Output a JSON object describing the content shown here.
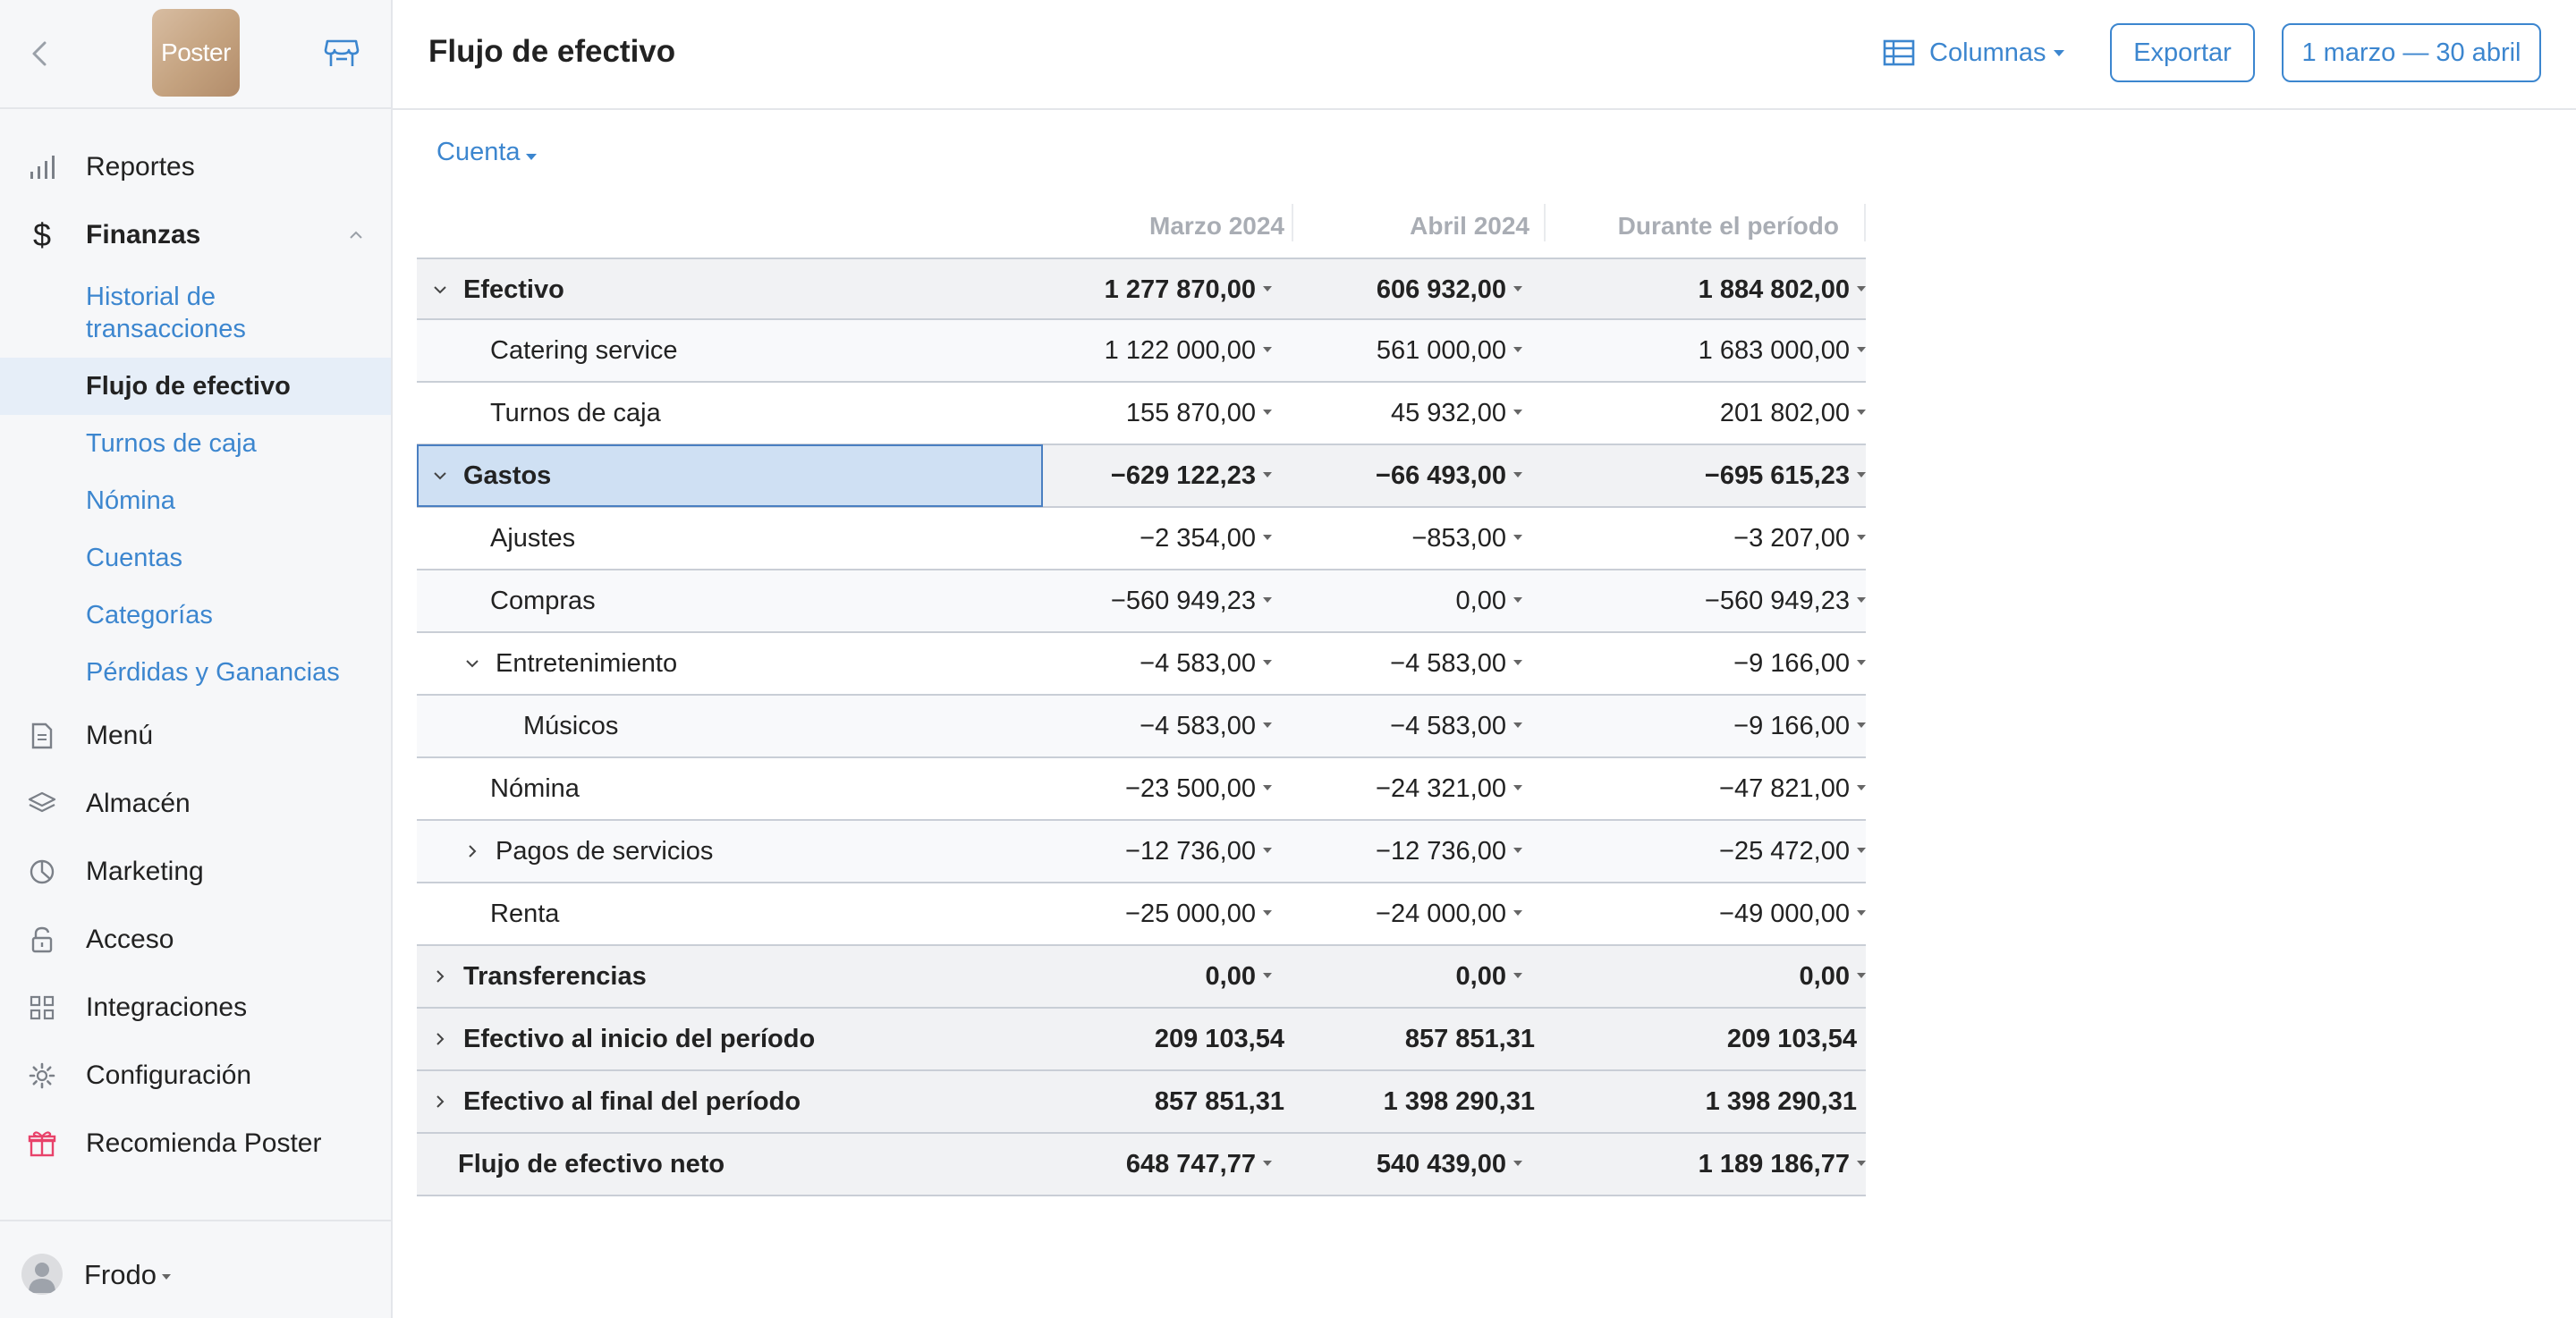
{
  "sidebar": {
    "logo_text": "Poster",
    "nav": [
      {
        "label": "Reportes",
        "icon": "bar-chart-icon"
      },
      {
        "label": "Finanzas",
        "icon": "dollar-icon"
      },
      {
        "label": "Menú",
        "icon": "document-icon"
      },
      {
        "label": "Almacén",
        "icon": "layers-icon"
      },
      {
        "label": "Marketing",
        "icon": "pie-icon"
      },
      {
        "label": "Acceso",
        "icon": "lock-icon"
      },
      {
        "label": "Integraciones",
        "icon": "grid-icon"
      },
      {
        "label": "Configuración",
        "icon": "gear-icon"
      },
      {
        "label": "Recomienda Poster",
        "icon": "gift-icon"
      }
    ],
    "finanzas_sub": [
      {
        "label": "Historial de transacciones"
      },
      {
        "label": "Flujo de efectivo"
      },
      {
        "label": "Turnos de caja"
      },
      {
        "label": "Nómina"
      },
      {
        "label": "Cuentas"
      },
      {
        "label": "Categorías"
      },
      {
        "label": "Pérdidas y Ganancias"
      }
    ],
    "user": "Frodo"
  },
  "header": {
    "title": "Flujo de efectivo",
    "columns_label": "Columnas",
    "export_label": "Exportar",
    "date_range": "1 marzo — 30 abril"
  },
  "filter_label": "Cuenta",
  "table": {
    "columns": [
      "Marzo 2024",
      "Abril 2024",
      "Durante el período"
    ],
    "rows": [
      {
        "label": "Efectivo",
        "values": [
          "1 277 870,00",
          "606 932,00",
          "1 884 802,00"
        ]
      },
      {
        "label": "Catering service",
        "values": [
          "1 122 000,00",
          "561 000,00",
          "1 683 000,00"
        ]
      },
      {
        "label": "Turnos de caja",
        "values": [
          "155 870,00",
          "45 932,00",
          "201 802,00"
        ]
      },
      {
        "label": "Gastos",
        "values": [
          "−629 122,23",
          "−66 493,00",
          "−695 615,23"
        ]
      },
      {
        "label": "Ajustes",
        "values": [
          "−2 354,00",
          "−853,00",
          "−3 207,00"
        ]
      },
      {
        "label": "Compras",
        "values": [
          "−560 949,23",
          "0,00",
          "−560 949,23"
        ]
      },
      {
        "label": "Entretenimiento",
        "values": [
          "−4 583,00",
          "−4 583,00",
          "−9 166,00"
        ]
      },
      {
        "label": "Músicos",
        "values": [
          "−4 583,00",
          "−4 583,00",
          "−9 166,00"
        ]
      },
      {
        "label": "Nómina",
        "values": [
          "−23 500,00",
          "−24 321,00",
          "−47 821,00"
        ]
      },
      {
        "label": "Pagos de servicios",
        "values": [
          "−12 736,00",
          "−12 736,00",
          "−25 472,00"
        ]
      },
      {
        "label": "Renta",
        "values": [
          "−25 000,00",
          "−24 000,00",
          "−49 000,00"
        ]
      },
      {
        "label": "Transferencias",
        "values": [
          "0,00",
          "0,00",
          "0,00"
        ]
      },
      {
        "label": "Efectivo al inicio del período",
        "values": [
          "209 103,54",
          "857 851,31",
          "209 103,54"
        ]
      },
      {
        "label": "Efectivo al final del período",
        "values": [
          "857 851,31",
          "1 398 290,31",
          "1 398 290,31"
        ]
      },
      {
        "label": "Flujo de efectivo neto",
        "values": [
          "648 747,77",
          "540 439,00",
          "1 189 186,77"
        ]
      }
    ]
  },
  "colors": {
    "accent": "#3c86cf",
    "sidebar_bg": "#f6f7f9",
    "selected_bg": "#cfe0f3",
    "group_row_bg": "#f1f2f4",
    "gift_icon": "#e8426a"
  }
}
